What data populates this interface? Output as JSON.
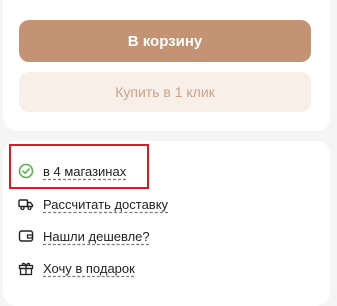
{
  "actions": {
    "add_to_cart": "В корзину",
    "buy_one_click": "Купить в 1 клик"
  },
  "info": {
    "availability": "в 4 магазинах",
    "calc_delivery": "Рассчитать доставку",
    "found_cheaper": "Нашли дешевле?",
    "want_gift": "Хочу в подарок"
  },
  "colors": {
    "primary": "#c39373",
    "secondary_bg": "#f8efe9",
    "secondary_text": "#c9a38b",
    "available_green": "#5bb24a",
    "highlight_red": "#e4161e"
  },
  "icons": {
    "availability": "check-circle-icon",
    "delivery": "truck-icon",
    "cheaper": "wallet-icon",
    "gift": "gift-icon"
  }
}
